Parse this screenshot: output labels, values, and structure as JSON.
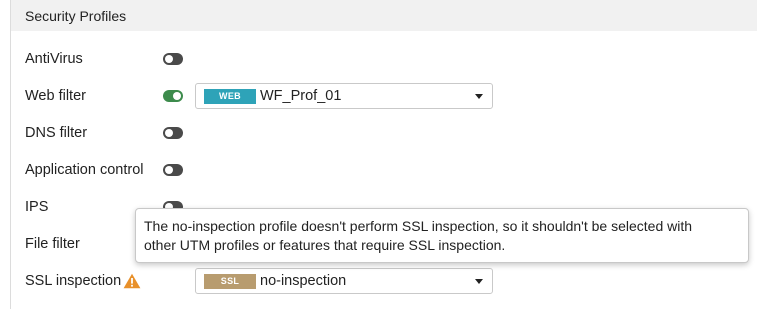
{
  "section": {
    "title": "Security Profiles"
  },
  "rows": {
    "antivirus": {
      "label": "AntiVirus",
      "toggle_state": "off"
    },
    "web_filter": {
      "label": "Web filter",
      "toggle_state": "on",
      "select": {
        "tag": "WEB",
        "tag_color": "#2ea3b8",
        "value": "WF_Prof_01"
      }
    },
    "dns_filter": {
      "label": "DNS filter",
      "toggle_state": "off"
    },
    "app_control": {
      "label": "Application control",
      "toggle_state": "off"
    },
    "ips": {
      "label": "IPS",
      "toggle_state": "off"
    },
    "file_filter": {
      "label": "File filter"
    },
    "ssl_inspection": {
      "label": "SSL inspection",
      "warning_icon": "warning-triangle-icon",
      "warning_color": "#e8902a",
      "select": {
        "tag": "SSL",
        "tag_color": "#b89c6f",
        "value": "no-inspection"
      }
    }
  },
  "tooltip": {
    "line1": "The no-inspection profile doesn't perform SSL inspection, so it shouldn't be selected with",
    "line2": "other UTM profiles or features that require SSL inspection."
  },
  "colors": {
    "toggle_on": "#3d8b4c",
    "toggle_off": "#4a4a4a",
    "header_bg": "#f1f1f1"
  }
}
